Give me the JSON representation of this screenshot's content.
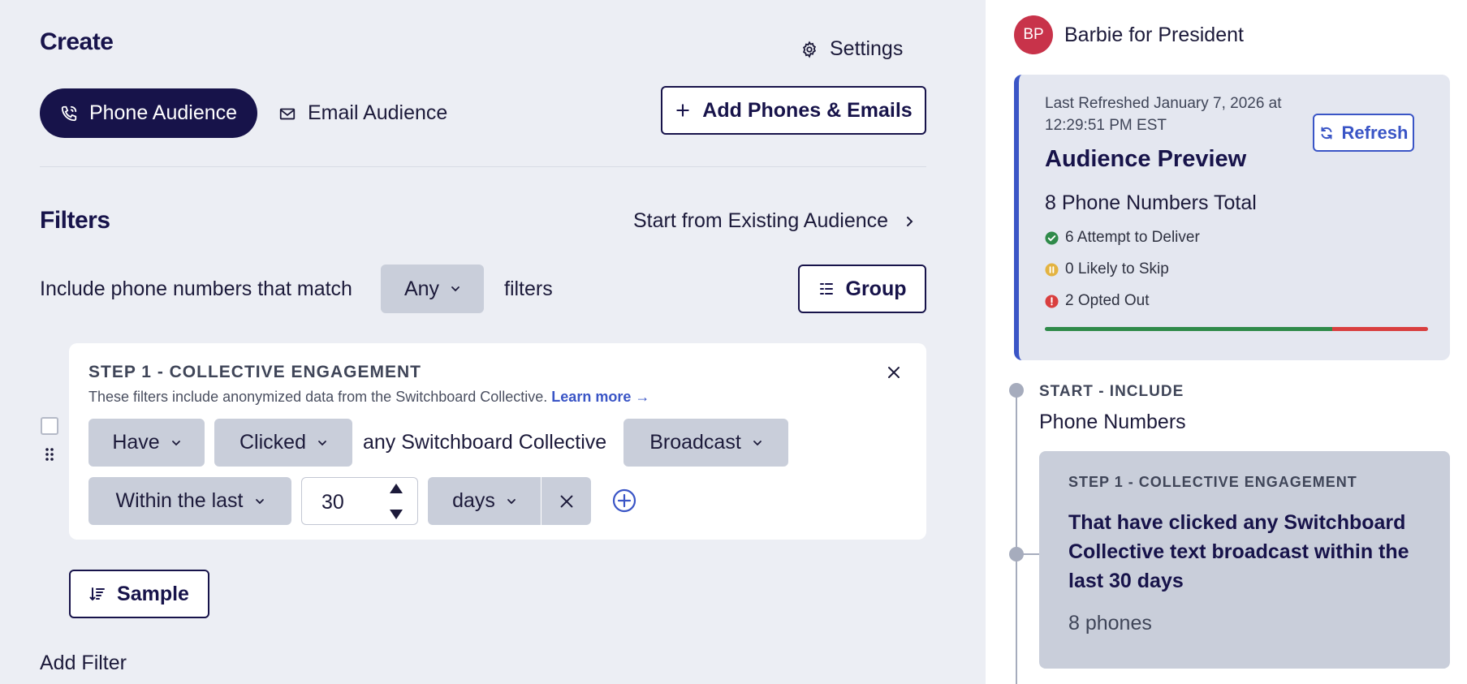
{
  "header": {
    "title": "Create",
    "settings_label": "Settings"
  },
  "tabs": {
    "phone_label": "Phone Audience",
    "email_label": "Email Audience"
  },
  "add_phones_label": "Add Phones & Emails",
  "filters": {
    "title": "Filters",
    "start_existing_label": "Start from Existing Audience",
    "include_label": "Include phone numbers that match",
    "match_value": "Any",
    "filters_word": "filters",
    "group_label": "Group"
  },
  "step1": {
    "title": "STEP 1 - COLLECTIVE ENGAGEMENT",
    "description": "These filters include anonymized data from the Switchboard Collective.",
    "learn_more": "Learn more →",
    "have_value": "Have",
    "action_value": "Clicked",
    "collective_text": "any Switchboard Collective",
    "type_value": "Broadcast",
    "timeframe_value": "Within the last",
    "number_value": "30",
    "unit_value": "days"
  },
  "sample_label": "Sample",
  "add_filter_label": "Add Filter",
  "sidebar": {
    "avatar_initials": "BP",
    "org_name": "Barbie for President",
    "preview": {
      "last_refreshed": "Last Refreshed January 7, 2026 at 12:29:51 PM EST",
      "refresh_label": "Refresh",
      "title": "Audience Preview",
      "total": "8 Phone Numbers Total",
      "stats": [
        {
          "label": "6 Attempt to Deliver",
          "color": "#2f8a4a"
        },
        {
          "label": "0 Likely to Skip",
          "color": "#e3b341"
        },
        {
          "label": "2 Opted Out",
          "color": "#d93f3f"
        }
      ],
      "progress": {
        "deliver": 6,
        "skip": 0,
        "opted_out": 2
      }
    },
    "timeline": {
      "start_label": "START - INCLUDE",
      "start_sub": "Phone Numbers",
      "step_title": "STEP 1 - COLLECTIVE ENGAGEMENT",
      "step_desc": "That have clicked any Switchboard Collective text broadcast within the last 30 days",
      "step_count": "8 phones"
    }
  },
  "colors": {
    "brand": "#17134a",
    "accent": "#3a55c6",
    "select_bg": "#c9ceda"
  }
}
